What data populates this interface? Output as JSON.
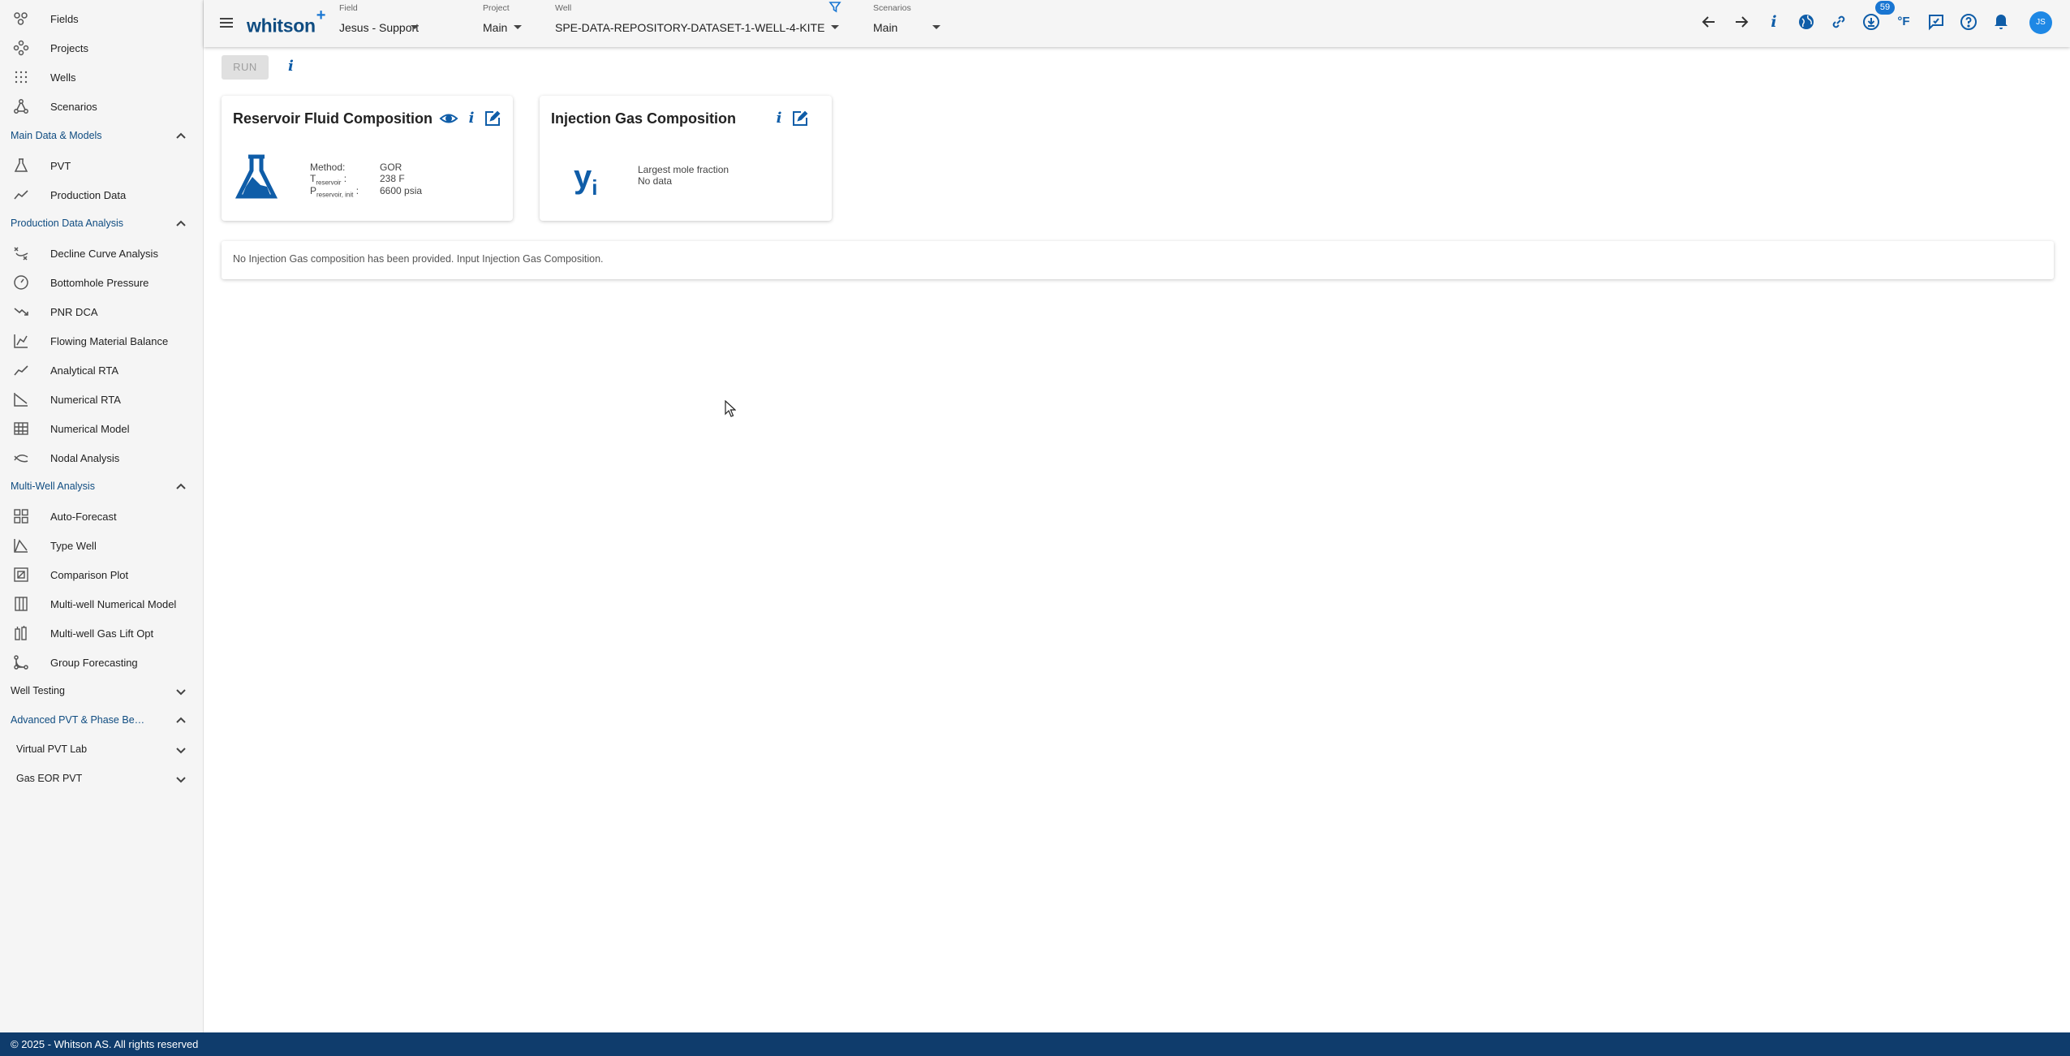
{
  "sidebar": {
    "top_items": [
      {
        "label": "Fields",
        "icon": "fields-icon"
      },
      {
        "label": "Projects",
        "icon": "projects-icon"
      },
      {
        "label": "Wells",
        "icon": "wells-icon"
      },
      {
        "label": "Scenarios",
        "icon": "scenarios-icon"
      }
    ],
    "sections": {
      "main_data": {
        "label": "Main Data & Models",
        "items": [
          "PVT",
          "Production Data"
        ]
      },
      "pda": {
        "label": "Production Data Analysis",
        "items": [
          "Decline Curve Analysis",
          "Bottomhole Pressure",
          "PNR DCA",
          "Flowing Material Balance",
          "Analytical RTA",
          "Numerical RTA",
          "Numerical Model",
          "Nodal Analysis"
        ]
      },
      "mwa": {
        "label": "Multi-Well Analysis",
        "items": [
          "Auto-Forecast",
          "Type Well",
          "Comparison Plot",
          "Multi-well Numerical Model",
          "Multi-well Gas Lift Opt",
          "Group Forecasting"
        ]
      },
      "well_testing": {
        "label": "Well Testing"
      },
      "advanced_pvt": {
        "label": "Advanced PVT & Phase Behavior",
        "subsections": [
          "Virtual PVT Lab",
          "Gas EOR PVT"
        ]
      }
    }
  },
  "header": {
    "logo": "whitson",
    "logo_plus": "+",
    "field": {
      "caption": "Field",
      "value": "Jesus - Support"
    },
    "project": {
      "caption": "Project",
      "value": "Main"
    },
    "well": {
      "caption": "Well",
      "value": "SPE-DATA-REPOSITORY-DATASET-1-WELL-4-KITE"
    },
    "scenarios": {
      "caption": "Scenarios",
      "value": "Main"
    },
    "temp_unit": "°F",
    "notifications_count": "59",
    "avatar_initials": "JS"
  },
  "toolbar": {
    "run_label": "RUN",
    "info_label": "i"
  },
  "reservoir_card": {
    "title": "Reservoir Fluid Composition",
    "method_label": "Method:",
    "method_value": "GOR",
    "t_label": "T",
    "t_sub": "reservoir",
    "t_value": "238 F",
    "p_label": "P",
    "p_sub": "reservoir, init",
    "p_value": "6600 psia"
  },
  "injection_card": {
    "title": "Injection Gas Composition",
    "symbol": "y",
    "symbol_sub": "i",
    "line1": "Largest mole fraction",
    "line2": "No data"
  },
  "notice": "No Injection Gas composition has been provided. Input Injection Gas Composition.",
  "footer": "© 2025 - Whitson AS. All rights reserved",
  "colors": {
    "brand": "#0f4c81",
    "accent": "#0f5da8",
    "footer": "#0f3c6c"
  }
}
